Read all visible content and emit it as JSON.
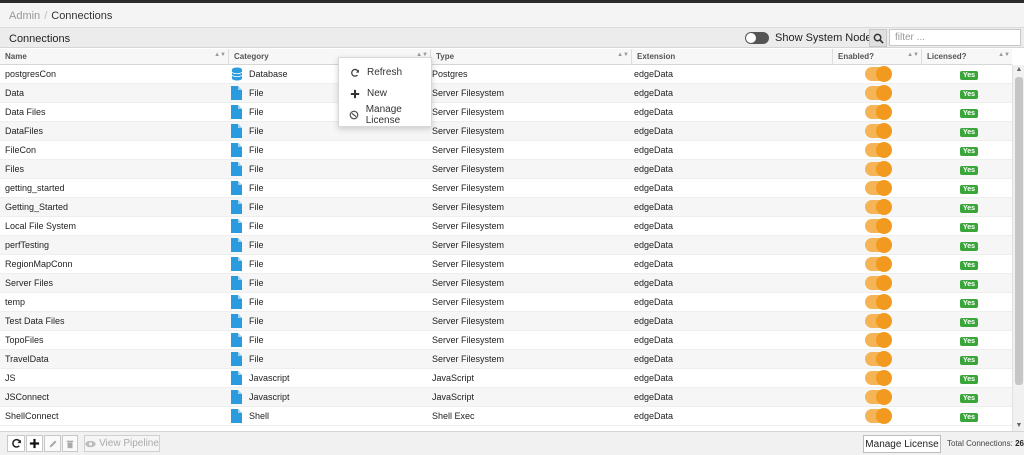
{
  "breadcrumb": {
    "root": "Admin",
    "separator": "/",
    "current": "Connections"
  },
  "panel": {
    "title": "Connections",
    "show_system_nodes_label": "Show System Nodes",
    "filter_placeholder": "filter ..."
  },
  "columns": [
    "Name",
    "Category",
    "Type",
    "Extension",
    "Enabled?",
    "Licensed?"
  ],
  "rows": [
    {
      "name": "postgresCon",
      "category": "Database",
      "type": "Postgres",
      "extension": "edgeData",
      "licensed": "Yes"
    },
    {
      "name": "Data",
      "category": "File",
      "type": "Server Filesystem",
      "extension": "edgeData",
      "licensed": "Yes"
    },
    {
      "name": "Data Files",
      "category": "File",
      "type": "Server Filesystem",
      "extension": "edgeData",
      "licensed": "Yes"
    },
    {
      "name": "DataFiles",
      "category": "File",
      "type": "Server Filesystem",
      "extension": "edgeData",
      "licensed": "Yes"
    },
    {
      "name": "FileCon",
      "category": "File",
      "type": "Server Filesystem",
      "extension": "edgeData",
      "licensed": "Yes"
    },
    {
      "name": "Files",
      "category": "File",
      "type": "Server Filesystem",
      "extension": "edgeData",
      "licensed": "Yes"
    },
    {
      "name": "getting_started",
      "category": "File",
      "type": "Server Filesystem",
      "extension": "edgeData",
      "licensed": "Yes"
    },
    {
      "name": "Getting_Started",
      "category": "File",
      "type": "Server Filesystem",
      "extension": "edgeData",
      "licensed": "Yes"
    },
    {
      "name": "Local File System",
      "category": "File",
      "type": "Server Filesystem",
      "extension": "edgeData",
      "licensed": "Yes"
    },
    {
      "name": "perfTesting",
      "category": "File",
      "type": "Server Filesystem",
      "extension": "edgeData",
      "licensed": "Yes"
    },
    {
      "name": "RegionMapConn",
      "category": "File",
      "type": "Server Filesystem",
      "extension": "edgeData",
      "licensed": "Yes"
    },
    {
      "name": "Server Files",
      "category": "File",
      "type": "Server Filesystem",
      "extension": "edgeData",
      "licensed": "Yes"
    },
    {
      "name": "temp",
      "category": "File",
      "type": "Server Filesystem",
      "extension": "edgeData",
      "licensed": "Yes"
    },
    {
      "name": "Test Data Files",
      "category": "File",
      "type": "Server Filesystem",
      "extension": "edgeData",
      "licensed": "Yes"
    },
    {
      "name": "TopoFiles",
      "category": "File",
      "type": "Server Filesystem",
      "extension": "edgeData",
      "licensed": "Yes"
    },
    {
      "name": "TravelData",
      "category": "File",
      "type": "Server Filesystem",
      "extension": "edgeData",
      "licensed": "Yes"
    },
    {
      "name": "JS",
      "category": "Javascript",
      "type": "JavaScript",
      "extension": "edgeData",
      "licensed": "Yes"
    },
    {
      "name": "JSConnect",
      "category": "Javascript",
      "type": "JavaScript",
      "extension": "edgeData",
      "licensed": "Yes"
    },
    {
      "name": "ShellConnect",
      "category": "Shell",
      "type": "Shell Exec",
      "extension": "edgeData",
      "licensed": "Yes"
    }
  ],
  "context_menu": {
    "refresh": "Refresh",
    "new": "New",
    "manage_license": "Manage License"
  },
  "footer": {
    "view_pipeline": "View Pipeline",
    "manage_license": "Manage License",
    "total_label": "Total Connections:",
    "total_value": "26"
  },
  "colors": {
    "toggle_on": "#f29a1f",
    "badge_green": "#3aa63a",
    "folder_blue": "#2b9be0"
  }
}
